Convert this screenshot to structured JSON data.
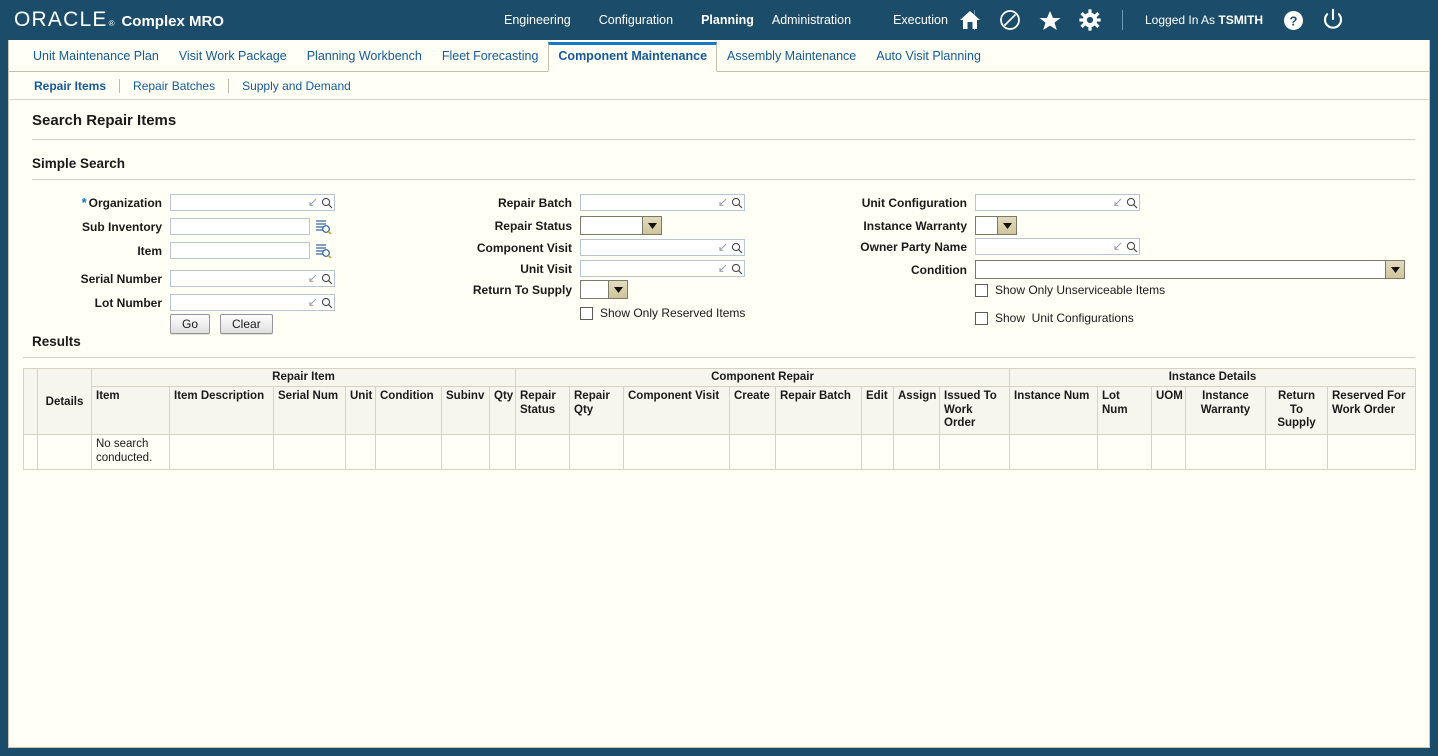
{
  "brand": {
    "oracle": "ORACLE",
    "registered": "®",
    "app_name": "Complex MRO",
    "accent_dark": "#1b4d6b",
    "accent_link": "#13599c",
    "accent_tab": "#1878c8"
  },
  "global_nav": {
    "items": [
      {
        "label": "Engineering",
        "active": false
      },
      {
        "label": "Configuration",
        "active": false
      },
      {
        "label": "Planning",
        "active": true
      },
      {
        "label": "Administration",
        "active": false
      },
      {
        "label": "Execution",
        "active": false
      }
    ],
    "icons": [
      {
        "name": "home-icon"
      },
      {
        "name": "navigator-icon"
      },
      {
        "name": "favorites-star-icon"
      },
      {
        "name": "settings-gear-icon"
      }
    ],
    "logged_in_prefix": "Logged In As ",
    "logged_in_user": "TSMITH",
    "help_icon": "help-icon",
    "logout_icon": "power-logout-icon"
  },
  "tabs_level1": [
    {
      "label": "Unit Maintenance Plan",
      "active": false
    },
    {
      "label": "Visit Work Package",
      "active": false
    },
    {
      "label": "Planning Workbench",
      "active": false
    },
    {
      "label": "Fleet Forecasting",
      "active": false
    },
    {
      "label": "Component Maintenance",
      "active": true
    },
    {
      "label": "Assembly Maintenance",
      "active": false
    },
    {
      "label": "Auto Visit Planning",
      "active": false
    }
  ],
  "tabs_level2": [
    {
      "label": "Repair Items",
      "active": true
    },
    {
      "label": "Repair Batches",
      "active": false
    },
    {
      "label": "Supply and Demand",
      "active": false
    }
  ],
  "page": {
    "title": "Search Repair Items",
    "simple_search_heading": "Simple Search",
    "results_heading": "Results"
  },
  "form": {
    "organization": {
      "label": "Organization",
      "value": "",
      "required": true,
      "control": "lov-inline"
    },
    "sub_inventory": {
      "label": "Sub Inventory",
      "value": "",
      "required": false,
      "control": "lov-external"
    },
    "item": {
      "label": "Item",
      "value": "",
      "required": false,
      "control": "lov-external"
    },
    "serial_number": {
      "label": "Serial Number",
      "value": "",
      "required": false,
      "control": "lov-inline"
    },
    "lot_number": {
      "label": "Lot Number",
      "value": "",
      "required": false,
      "control": "lov-inline"
    },
    "repair_batch": {
      "label": "Repair Batch",
      "value": "",
      "control": "lov-inline"
    },
    "repair_status": {
      "label": "Repair Status",
      "value": "",
      "control": "dropdown",
      "options": [
        ""
      ]
    },
    "component_visit": {
      "label": "Component Visit",
      "value": "",
      "control": "lov-inline"
    },
    "unit_visit": {
      "label": "Unit Visit",
      "value": "",
      "control": "lov-inline"
    },
    "return_to_supply": {
      "label": "Return To Supply",
      "value": "",
      "control": "dropdown",
      "options": [
        ""
      ]
    },
    "unit_configuration": {
      "label": "Unit Configuration",
      "value": "",
      "control": "lov-inline"
    },
    "instance_warranty": {
      "label": "Instance Warranty",
      "value": "",
      "control": "dropdown",
      "options": [
        ""
      ]
    },
    "owner_party_name": {
      "label": "Owner Party Name",
      "value": "",
      "control": "lov-inline"
    },
    "condition": {
      "label": "Condition",
      "value": "",
      "control": "dropdown",
      "options": [
        ""
      ]
    },
    "buttons": {
      "go": "Go",
      "clear": "Clear"
    },
    "checkboxes": {
      "show_only_reserved_items": {
        "label": "Show Only Reserved Items",
        "checked": false
      },
      "show_only_unserviceable_items": {
        "label": "Show Only Unserviceable Items",
        "checked": false
      },
      "show_unit_configurations": {
        "label": "Show  Unit Configurations",
        "checked": false
      }
    }
  },
  "results_table": {
    "group_headers": [
      {
        "label": "Repair Item",
        "span": 8
      },
      {
        "label": "Component Repair",
        "span": 7
      },
      {
        "label": "Instance Details",
        "span": 6
      }
    ],
    "details_header": "Details",
    "columns": [
      "Item",
      "Item Description",
      "Serial Num",
      "Unit",
      "Condition",
      "Subinv",
      "Qty",
      "Repair Status",
      "Repair Qty",
      "Component Visit",
      "Create",
      "Repair Batch",
      "Edit",
      "Assign",
      "Issued To Work Order",
      "Instance Num",
      "Lot Num",
      "UOM",
      "Instance Warranty",
      "Return To Supply",
      "Reserved For Work Order"
    ],
    "rows": [
      {
        "select": "",
        "details": "",
        "cells": [
          "No search conducted.",
          "",
          "",
          "",
          "",
          "",
          "",
          "",
          "",
          "",
          "",
          "",
          "",
          "",
          "",
          "",
          "",
          "",
          "",
          "",
          ""
        ]
      }
    ]
  }
}
